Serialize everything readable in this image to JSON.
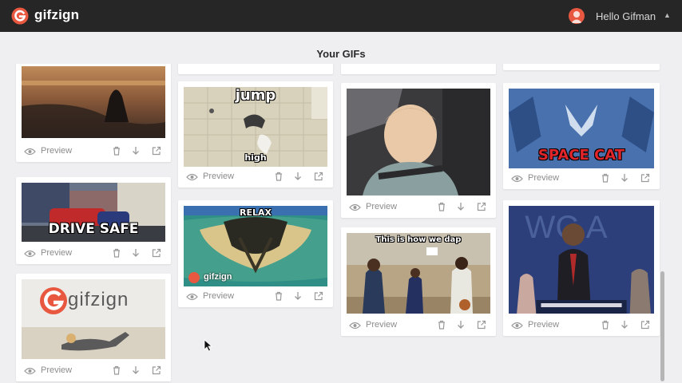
{
  "app": {
    "brand": "gifzign",
    "user_greeting": "Hello Gifman"
  },
  "page": {
    "title": "Your GIFs"
  },
  "card_actions": {
    "preview_label": "Preview",
    "delete": "trash-icon",
    "download": "download-icon",
    "open": "external-link-icon"
  },
  "gifs": [
    {
      "id": "sunset-beach",
      "caption": ""
    },
    {
      "id": "jump-high",
      "caption_top": "jump",
      "caption_bottom": "high"
    },
    {
      "id": "sleepy-baby",
      "caption": ""
    },
    {
      "id": "space-cat",
      "caption": "SPACE CAT"
    },
    {
      "id": "drive-safe",
      "caption": "DRIVE SAFE"
    },
    {
      "id": "relax",
      "caption": "RELAX",
      "watermark": "gifzign"
    },
    {
      "id": "dap",
      "caption": "This is how we dap"
    },
    {
      "id": "obama",
      "caption": ""
    },
    {
      "id": "gifzign-beach",
      "logo_text": "gifzign"
    }
  ],
  "colors": {
    "topbar": "#262626",
    "brand_accent": "#e8573f",
    "background": "#efeff1",
    "space_cat_text": "#e0262a"
  }
}
